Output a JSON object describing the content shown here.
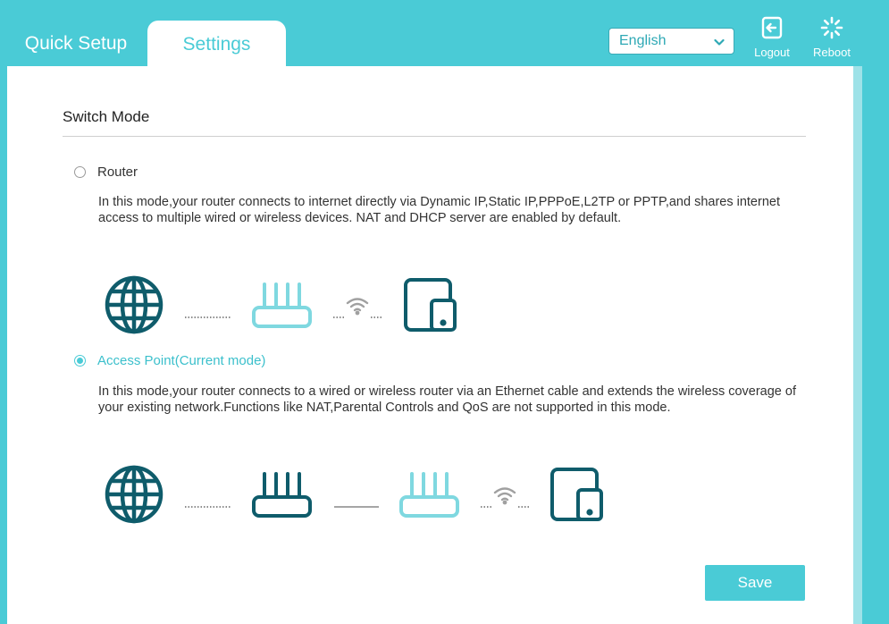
{
  "tabs": {
    "quick_setup": "Quick Setup",
    "settings": "Settings"
  },
  "header": {
    "language": "English",
    "logout": "Logout",
    "reboot": "Reboot"
  },
  "section": {
    "title": "Switch Mode"
  },
  "modes": {
    "router": {
      "label": "Router",
      "selected": false,
      "description": "In this mode,your router connects to internet directly via Dynamic IP,Static IP,PPPoE,L2TP or PPTP,and shares internet access to multiple wired or wireless devices. NAT and DHCP server are enabled by default."
    },
    "access_point": {
      "label": "Access Point(Current mode)",
      "selected": true,
      "description": "In this mode,your router connects to a wired or wireless router via an Ethernet cable and extends the wireless coverage of your existing network.Functions like NAT,Parental Controls and QoS are not supported in this mode."
    }
  },
  "diagram_icons": {
    "router_mode": [
      "globe-icon",
      "router-icon",
      "wifi-icon",
      "device-icon"
    ],
    "access_point_mode": [
      "globe-icon",
      "router-icon",
      "router-icon",
      "wifi-icon",
      "device-icon"
    ]
  },
  "actions": {
    "save": "Save"
  },
  "colors": {
    "accent": "#4acbd6",
    "dark_teal": "#0f5c6b",
    "light_teal": "#7fd8e0"
  }
}
